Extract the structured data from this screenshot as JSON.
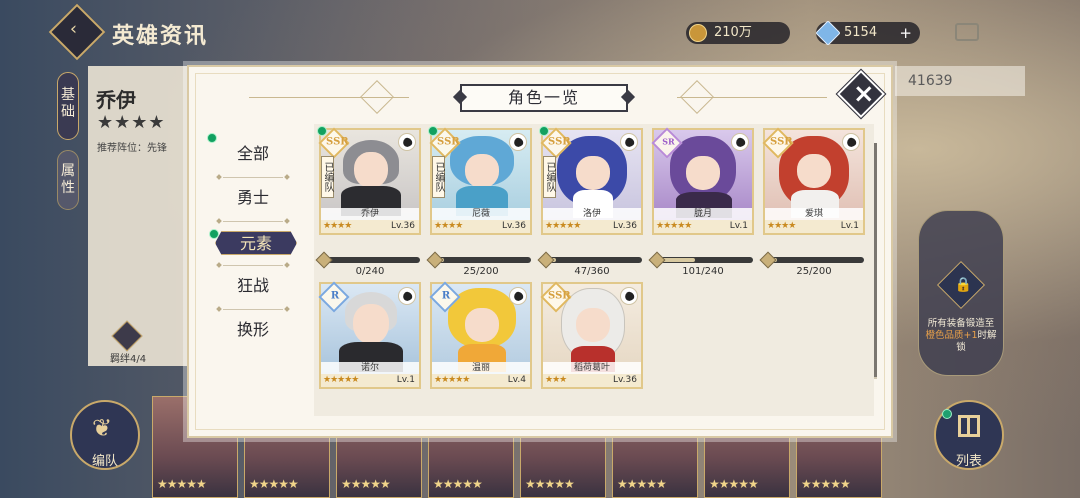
{
  "header": {
    "title": "英雄资讯",
    "gold": "210万",
    "gems": "5154",
    "power": "41639"
  },
  "hero_panel": {
    "name": "乔伊",
    "stars": "★★★★",
    "recommended": "推荐阵位：先锋",
    "tab_basic": "基础",
    "tab_attr": "属性",
    "bond": "羁绊4/4"
  },
  "lock_hint": {
    "line1": "所有装备锻造至",
    "highlight": "橙色品质+1",
    "line2": "时解锁"
  },
  "buttons": {
    "team": "编队",
    "list": "列表"
  },
  "modal": {
    "title": "角色一览",
    "filters": [
      "全部",
      "勇士",
      "元素",
      "狂战",
      "换形"
    ],
    "active_filter": "元素"
  },
  "heroes": [
    {
      "name": "乔伊",
      "stars": "★★★★",
      "level": "Lv.36",
      "rarity": "SSR",
      "in_team": "已编队",
      "fragments": "0/240",
      "progress": 0.0
    },
    {
      "name": "尼薇",
      "stars": "★★★★",
      "level": "Lv.36",
      "rarity": "SSR",
      "in_team": "已编队",
      "fragments": "25/200",
      "progress": 0.125
    },
    {
      "name": "洛伊",
      "stars": "★★★★★",
      "level": "Lv.36",
      "rarity": "SSR",
      "in_team": "已编队",
      "fragments": "47/360",
      "progress": 0.13
    },
    {
      "name": "胧月",
      "stars": "★★★★★",
      "level": "Lv.1",
      "rarity": "SR",
      "in_team": "",
      "fragments": "101/240",
      "progress": 0.42
    },
    {
      "name": "爱琪",
      "stars": "★★★★",
      "level": "Lv.1",
      "rarity": "SSR",
      "in_team": "",
      "fragments": "25/200",
      "progress": 0.125
    },
    {
      "name": "诺尔",
      "stars": "★★★★★",
      "level": "Lv.1",
      "rarity": "R",
      "in_team": "",
      "fragments": "",
      "progress": null
    },
    {
      "name": "温丽",
      "stars": "★★★★★",
      "level": "Lv.4",
      "rarity": "R",
      "in_team": "",
      "fragments": "",
      "progress": null
    },
    {
      "name": "稻荷葛叶",
      "stars": "★★★",
      "level": "Lv.36",
      "rarity": "SSR",
      "in_team": "",
      "fragments": "",
      "progress": null
    }
  ],
  "colors": {
    "accent": "#3b3a60",
    "gold_border": "#e1c88a",
    "green_dot": "#12a060"
  }
}
